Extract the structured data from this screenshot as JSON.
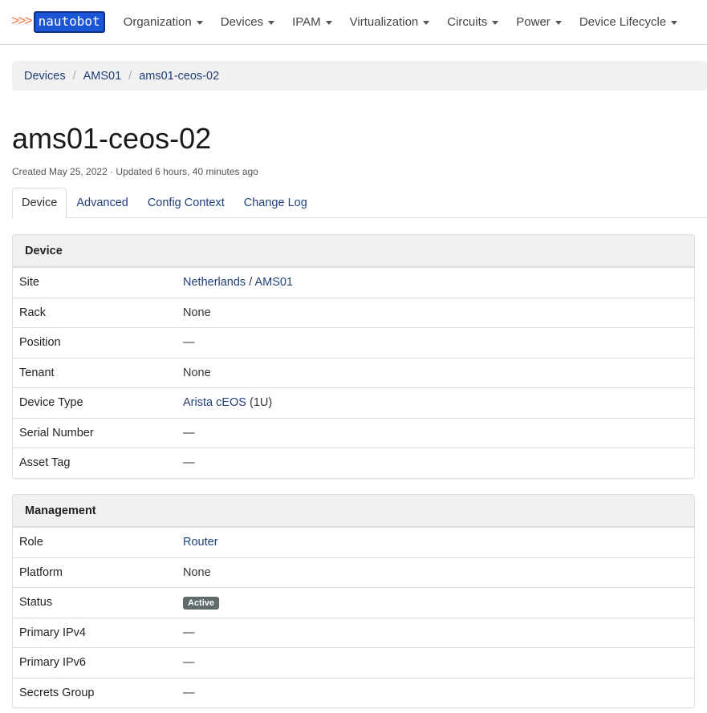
{
  "brand": {
    "arrows": ">>>",
    "name": "nautobot"
  },
  "nav": [
    {
      "label": "Organization"
    },
    {
      "label": "Devices"
    },
    {
      "label": "IPAM"
    },
    {
      "label": "Virtualization"
    },
    {
      "label": "Circuits"
    },
    {
      "label": "Power"
    },
    {
      "label": "Device Lifecycle"
    }
  ],
  "breadcrumb": [
    "Devices",
    "AMS01",
    "ams01-ceos-02"
  ],
  "page": {
    "title": "ams01-ceos-02",
    "meta": "Created May 25, 2022 · Updated 6 hours, 40 minutes ago"
  },
  "tabs": [
    "Device",
    "Advanced",
    "Config Context",
    "Change Log"
  ],
  "device_panel": {
    "heading": "Device",
    "site_label": "Site",
    "site_region": "Netherlands",
    "site_sep": " / ",
    "site_name": "AMS01",
    "rack_label": "Rack",
    "rack_value": "None",
    "position_label": "Position",
    "position_value": "—",
    "tenant_label": "Tenant",
    "tenant_value": "None",
    "type_label": "Device Type",
    "type_value": "Arista cEOS",
    "type_suffix": " (1U)",
    "serial_label": "Serial Number",
    "serial_value": "—",
    "asset_label": "Asset Tag",
    "asset_value": "—"
  },
  "mgmt_panel": {
    "heading": "Management",
    "role_label": "Role",
    "role_value": "Router",
    "platform_label": "Platform",
    "platform_value": "None",
    "status_label": "Status",
    "status_value": "Active",
    "ipv4_label": "Primary IPv4",
    "ipv4_value": "—",
    "ipv6_label": "Primary IPv6",
    "ipv6_value": "—",
    "secrets_label": "Secrets Group",
    "secrets_value": "—"
  },
  "colors": {
    "link": "#1f3f7a",
    "brand": "#1c55d6",
    "arrows": "#ef6f3a",
    "status_badge": "#5f6a6a"
  }
}
